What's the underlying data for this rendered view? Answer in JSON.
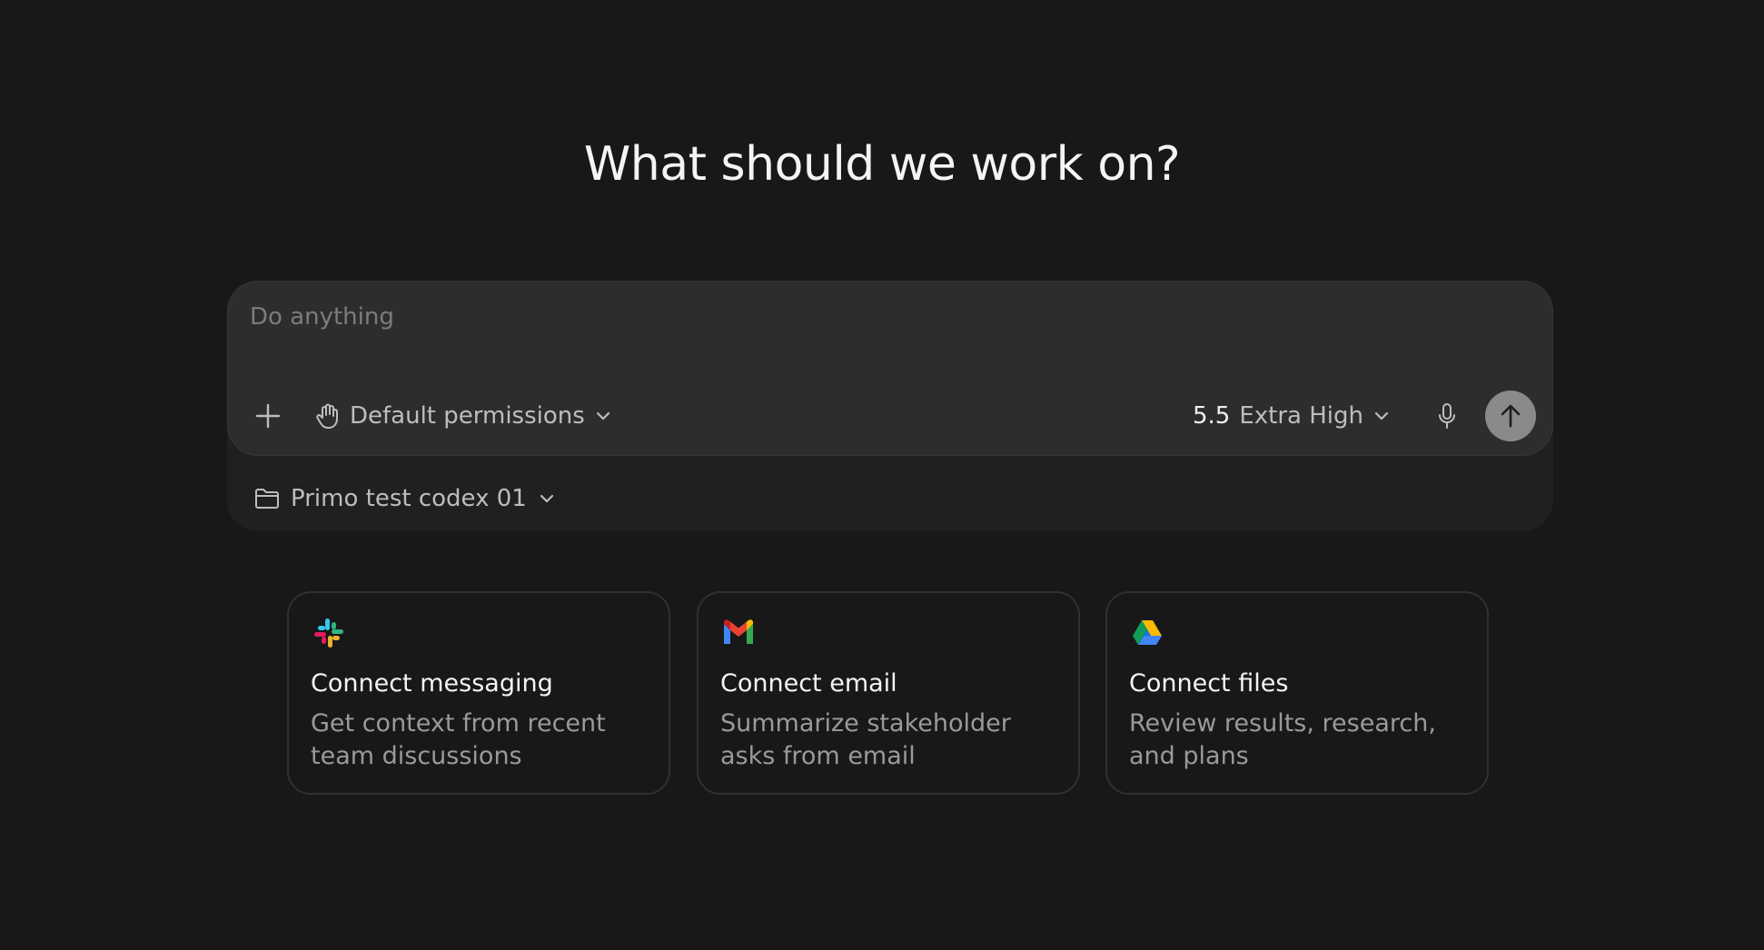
{
  "heading": "What should we work on?",
  "composer": {
    "placeholder": "Do anything",
    "permissions_label": "Default permissions",
    "model_version": "5.5",
    "model_effort": "Extra High",
    "project_label": "Primo test codex 01"
  },
  "icons": {
    "plus": "plus-icon",
    "permissions": "hand-icon",
    "chevron": "chevron-down-icon",
    "mic": "microphone-icon",
    "send": "arrow-up-icon",
    "project": "folder-icon"
  },
  "cards": [
    {
      "icon": "slack-icon",
      "title": "Connect messaging",
      "description": "Get context from recent team discussions"
    },
    {
      "icon": "gmail-icon",
      "title": "Connect email",
      "description": "Summarize stakeholder asks from email"
    },
    {
      "icon": "google-drive-icon",
      "title": "Connect files",
      "description": "Review results, research, and plans"
    }
  ],
  "colors": {
    "background": "#181818",
    "composer": "#2d2d2d",
    "send_button": "#8a8a8a"
  }
}
